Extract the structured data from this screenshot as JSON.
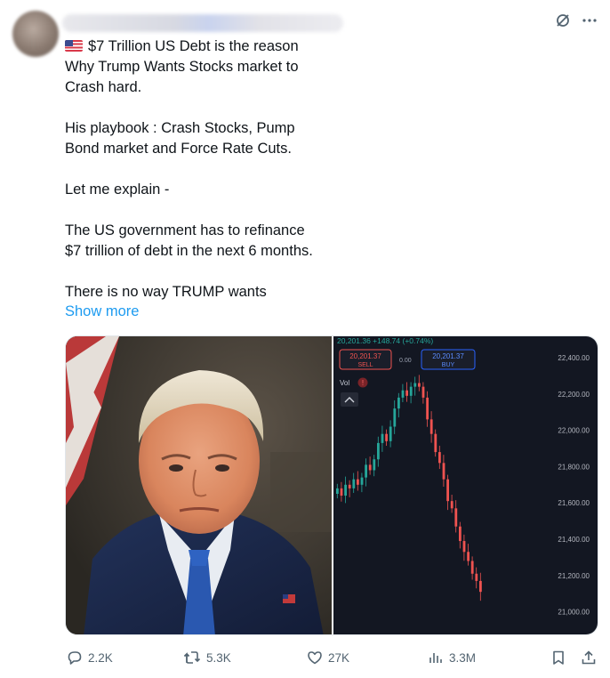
{
  "tweet": {
    "flag_icon": "us-flag-icon",
    "lines": [
      "$7 Trillion US Debt is the reason",
      "Why Trump Wants Stocks market to",
      "Crash hard.",
      "",
      "His playbook : Crash Stocks, Pump",
      "Bond market and Force Rate Cuts.",
      "",
      "Let me explain -",
      "",
      "The US government has to refinance",
      "$7 trillion of debt in the next 6 months.",
      "",
      "There is no way TRUMP wants"
    ],
    "show_more": "Show more"
  },
  "chart": {
    "header": "20,201.36 +148.74 (+0.74%)",
    "sell_price": "20,201.37",
    "sell_label": "SELL",
    "spread": "0.00",
    "buy_price": "20,201.37",
    "buy_label": "BUY",
    "vol_label": "Vol",
    "price_levels": [
      "22,400.00",
      "22,200.00",
      "22,000.00",
      "21,800.00",
      "21,600.00",
      "21,400.00",
      "21,200.00",
      "21,000.00"
    ],
    "colors": {
      "up": "#26a69a",
      "down": "#ef5350",
      "bg": "#131722"
    }
  },
  "actions": {
    "reply_count": "2.2K",
    "repost_count": "5.3K",
    "like_count": "27K",
    "views_count": "3.3M"
  }
}
